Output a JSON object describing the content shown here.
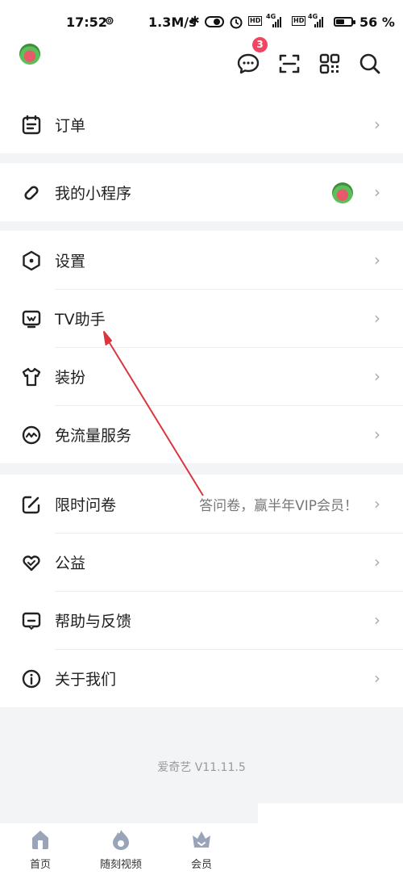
{
  "status_bar": {
    "time": "17:52",
    "speed": "1.3M/s",
    "battery_percent": "56",
    "battery_level": 0.56,
    "hd1": "HD",
    "hd2": "HD",
    "net1": "4G",
    "net2": "4G"
  },
  "header": {
    "message_badge": "3",
    "icons": [
      "message-icon",
      "scan-icon",
      "qrcode-icon",
      "search-icon"
    ]
  },
  "groups": [
    {
      "items": [
        {
          "icon": "order-icon",
          "label": "订单"
        }
      ]
    },
    {
      "items": [
        {
          "icon": "link-icon",
          "label": "我的小程序"
        }
      ]
    },
    {
      "items": [
        {
          "icon": "settings-icon",
          "label": "设置"
        },
        {
          "icon": "tv-icon",
          "label": "TV助手"
        },
        {
          "icon": "shirt-icon",
          "label": "装扮"
        },
        {
          "icon": "traffic-icon",
          "label": "免流量服务"
        }
      ]
    },
    {
      "items": [
        {
          "icon": "survey-icon",
          "label": "限时问卷",
          "promo": "答问卷，赢半年VIP会员！"
        },
        {
          "icon": "heart-icon",
          "label": "公益"
        },
        {
          "icon": "help-icon",
          "label": "帮助与反馈"
        },
        {
          "icon": "info-icon",
          "label": "关于我们"
        }
      ]
    }
  ],
  "chevron": "›",
  "footer": {
    "version": "爱奇艺 V11.11.5"
  },
  "tabbar": {
    "items": [
      {
        "icon": "home-icon",
        "label": "首页"
      },
      {
        "icon": "flame-icon",
        "label": "随刻视频"
      },
      {
        "icon": "crown-icon",
        "label": "会员"
      }
    ]
  },
  "colors": {
    "badge": "#f24462",
    "annotation_arrow": "#d9363e",
    "tab_icon": "#9aa4b8"
  }
}
